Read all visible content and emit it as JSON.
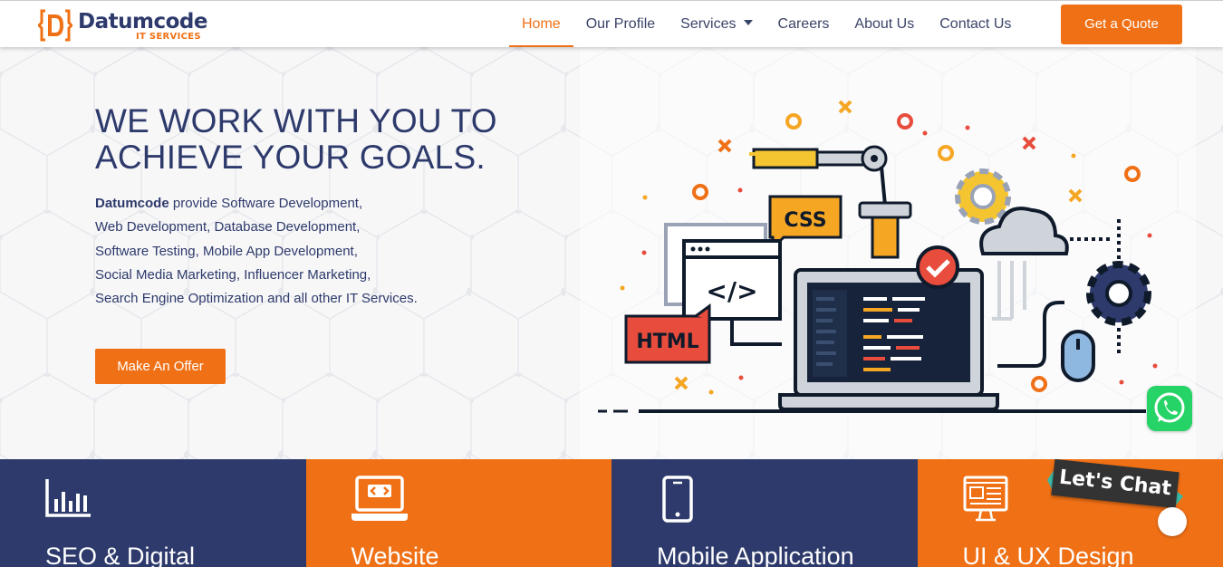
{
  "brand": {
    "name": "Datumcode",
    "sub": "IT SERVICES",
    "primary_color": "#2d3a6b",
    "accent_color": "#f07015"
  },
  "nav": {
    "items": [
      {
        "label": "Home",
        "active": true
      },
      {
        "label": "Our Profile"
      },
      {
        "label": "Services",
        "has_dropdown": true
      },
      {
        "label": "Careers"
      },
      {
        "label": "About Us"
      },
      {
        "label": "Contact Us"
      }
    ],
    "cta": "Get a Quote"
  },
  "hero": {
    "title_line1": "WE WORK WITH YOU TO",
    "title_line2": "ACHIEVE YOUR GOALS.",
    "desc_bold": "Datumcode",
    "desc_line1": " provide Software Development,",
    "desc_line2": "Web Development, Database Development,",
    "desc_line3": "Software Testing, Mobile App Development,",
    "desc_line4": "Social Media Marketing, Influencer Marketing,",
    "desc_line5": "Search Engine Optimization and all other IT Services.",
    "cta": "Make An Offer",
    "illustration": {
      "css_tag": "CSS",
      "html_tag": "HTML",
      "code_tag": "</>"
    }
  },
  "services": [
    {
      "title": "SEO & Digital",
      "icon": "bar-chart-icon",
      "color": "#2d3a6b"
    },
    {
      "title": "Website",
      "icon": "laptop-code-icon",
      "color": "#f07015"
    },
    {
      "title": "Mobile Application",
      "icon": "mobile-phone-icon",
      "color": "#2d3a6b"
    },
    {
      "title": "UI & UX Design",
      "icon": "monitor-design-icon",
      "color": "#f07015"
    }
  ],
  "widgets": {
    "whatsapp": "whatsapp-icon",
    "chat_label": "Let's Chat"
  }
}
